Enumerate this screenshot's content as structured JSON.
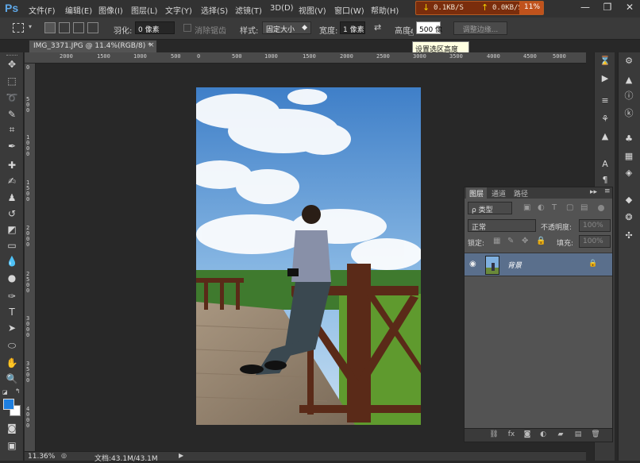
{
  "app": {
    "logo": "Ps"
  },
  "menu": [
    "文件(F)",
    "编辑(E)",
    "图像(I)",
    "图层(L)",
    "文字(Y)",
    "选择(S)",
    "滤镜(T)",
    "3D(D)",
    "视图(V)",
    "窗口(W)",
    "帮助(H)"
  ],
  "netmeter": {
    "down": "0.1KB/S",
    "up": "0.0KB/S",
    "cpu": "11%"
  },
  "window_buttons": [
    "minimize-icon",
    "restore-icon",
    "close-icon"
  ],
  "options": {
    "feather_label": "羽化:",
    "feather_value": "0 像素",
    "antialias_label": "消除锯齿",
    "style_label": "样式:",
    "style_value": "固定大小",
    "width_label": "宽度:",
    "width_value": "1 像素",
    "height_label": "高度:",
    "height_value": "500 像",
    "refine_label": "调整边缘..."
  },
  "tooltip": "设置选区高度",
  "document_tab": {
    "title": "IMG_3371.JPG @ 11.4%(RGB/8) *",
    "close": "×"
  },
  "ruler": {
    "top_ticks": [
      "2000",
      "1500",
      "1000",
      "500",
      "0",
      "500",
      "1000",
      "1500",
      "2000",
      "2500",
      "3000",
      "3500",
      "4000",
      "4500",
      "5000"
    ],
    "left_ticks": [
      "0",
      "5\n0\n0",
      "1\n0\n0\n0",
      "1\n5\n0\n0",
      "2\n0\n0\n0",
      "2\n5\n0\n0",
      "3\n0\n0\n0",
      "3\n5\n0\n0",
      "4\n0\n0\n0"
    ]
  },
  "status": {
    "zoom": "11.36%",
    "doc_label": "文档:43.1M/43.1M"
  },
  "tools": [
    "move-icon",
    "marquee-icon",
    "lasso-icon",
    "quick-select-icon",
    "crop-icon",
    "eyedropper-icon",
    "healing-icon",
    "brush-icon",
    "stamp-icon",
    "history-brush-icon",
    "eraser-icon",
    "gradient-icon",
    "blur-icon",
    "dodge-icon",
    "pen-icon",
    "type-icon",
    "path-select-icon",
    "shape-icon",
    "hand-icon",
    "zoom-icon"
  ],
  "layers_panel": {
    "tabs": [
      "图层",
      "通道",
      "路径"
    ],
    "filter_label": "ρ 类型",
    "blend_mode": "正常",
    "opacity_label": "不透明度:",
    "opacity_value": "100%",
    "lock_label": "锁定:",
    "fill_label": "填充:",
    "fill_value": "100%",
    "layer_name": "背景"
  },
  "colors": {
    "foreground": "#1e7fe0",
    "background": "#ffffff",
    "layer_selected": "#5a6f8c"
  }
}
